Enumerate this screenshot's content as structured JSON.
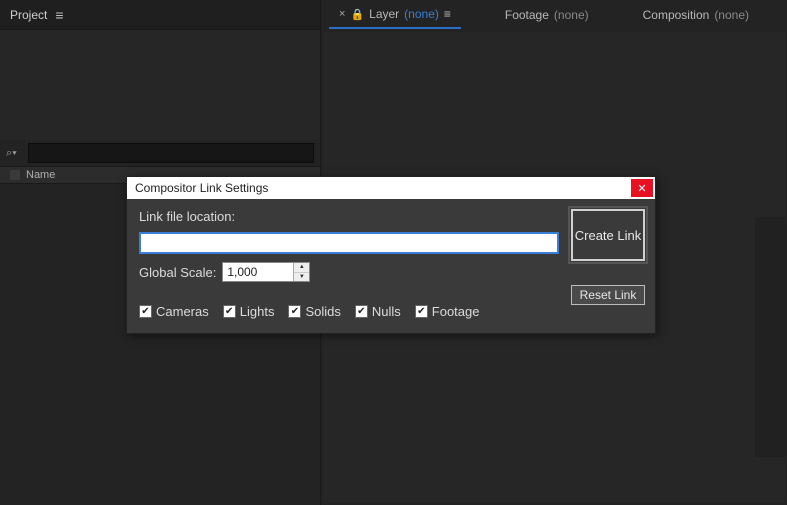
{
  "left_panel": {
    "title": "Project",
    "search_placeholder": "",
    "column_header": "Name"
  },
  "right_panel": {
    "tabs": [
      {
        "label": "Layer",
        "state": "(none)",
        "active": true,
        "closable": true,
        "locked": true
      },
      {
        "label": "Footage",
        "state": "(none)",
        "active": false
      },
      {
        "label": "Composition",
        "state": "(none)",
        "active": false
      }
    ]
  },
  "dialog": {
    "title": "Compositor Link Settings",
    "link_label": "Link file location:",
    "link_value": "",
    "scale_label": "Global Scale:",
    "scale_value": "1,000",
    "checkboxes": [
      {
        "label": "Cameras",
        "checked": true
      },
      {
        "label": "Lights",
        "checked": true
      },
      {
        "label": "Solids",
        "checked": true
      },
      {
        "label": "Nulls",
        "checked": true
      },
      {
        "label": "Footage",
        "checked": true
      }
    ],
    "create_button": "Create Link",
    "reset_button": "Reset Link"
  }
}
